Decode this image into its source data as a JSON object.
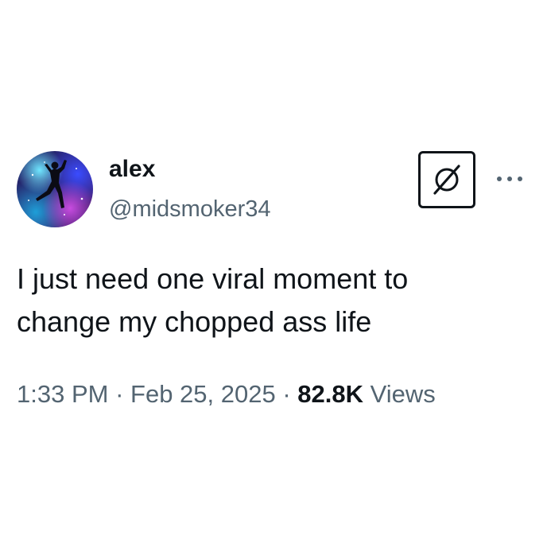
{
  "author": {
    "display_name": "alex",
    "handle": "@midsmoker34",
    "avatar_icon": "galaxy-jumpman-avatar"
  },
  "badge": {
    "icon": "diagonal-slash-circle-icon"
  },
  "menu": {
    "icon": "more-horizontal-icon"
  },
  "tweet": {
    "text_lines": [
      "I just need one viral moment to",
      "change my chopped ass life"
    ]
  },
  "meta": {
    "time": "1:33 PM",
    "separator": " · ",
    "date": "Feb 25, 2025",
    "views_count": "82.8K",
    "views_label": " Views"
  },
  "colors": {
    "text_primary": "#0f1419",
    "text_secondary": "#536471"
  }
}
